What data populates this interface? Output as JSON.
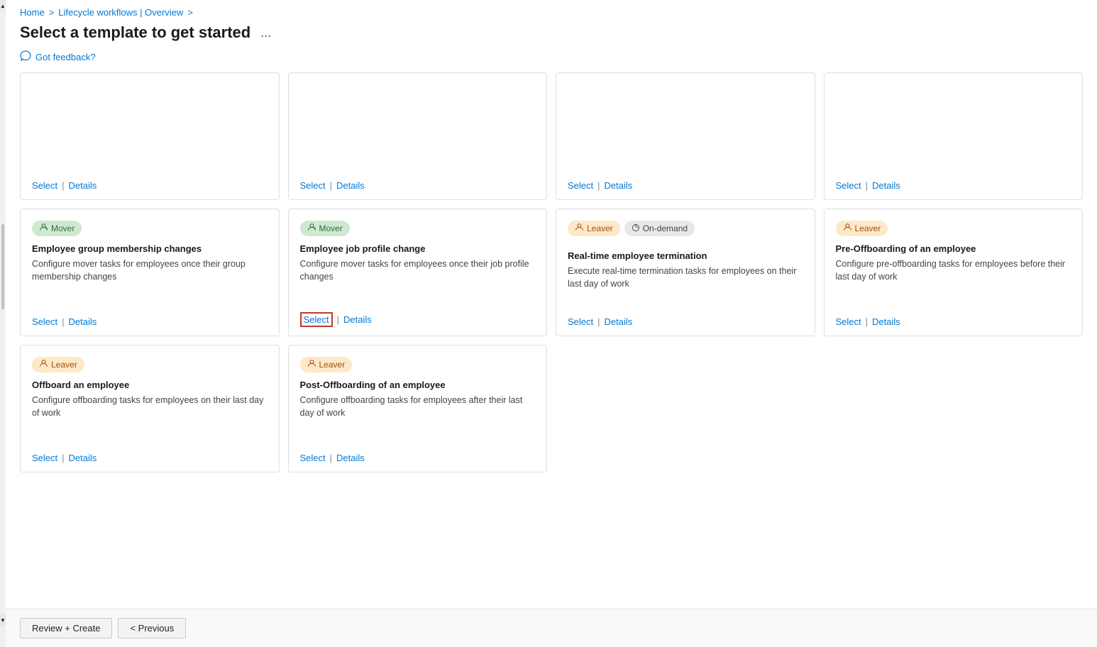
{
  "breadcrumb": {
    "home": "Home",
    "parent": "Lifecycle workflows | Overview",
    "sep1": ">",
    "sep2": ">"
  },
  "page": {
    "title": "Select a template to get started",
    "more_icon": "...",
    "feedback_icon": "💬",
    "feedback_text": "Got feedback?"
  },
  "cards_row1": [
    {
      "badge_type": "joiner",
      "badge_icon": "👤",
      "badge_label": "",
      "title": "",
      "desc": "",
      "select": "Select",
      "details": "Details"
    },
    {
      "badge_type": "joiner",
      "badge_icon": "👤",
      "badge_label": "",
      "title": "",
      "desc": "",
      "select": "Select",
      "details": "Details"
    },
    {
      "badge_type": "joiner",
      "badge_icon": "👤",
      "badge_label": "",
      "title": "",
      "desc": "",
      "select": "Select",
      "details": "Details"
    },
    {
      "badge_type": "joiner",
      "badge_icon": "👤",
      "badge_label": "",
      "title": "",
      "desc": "",
      "select": "Select",
      "details": "Details"
    }
  ],
  "cards_row2": [
    {
      "badge_type": "mover",
      "badge_icon": "🔄",
      "badge_label": "Mover",
      "title": "Employee group membership changes",
      "desc": "Configure mover tasks for employees once their group membership changes",
      "select": "Select",
      "details": "Details"
    },
    {
      "badge_type": "mover",
      "badge_icon": "🔄",
      "badge_label": "Mover",
      "title": "Employee job profile change",
      "desc": "Configure mover tasks for employees once their job profile changes",
      "select": "Select",
      "details": "Details",
      "select_highlighted": true
    },
    {
      "badge_type": "leaver",
      "badge_icon": "👤",
      "badge_label": "Leaver",
      "badge2_type": "ondemand",
      "badge2_label": "On-demand",
      "title": "Real-time employee termination",
      "desc": "Execute real-time termination tasks for employees on their last day of work",
      "select": "Select",
      "details": "Details"
    },
    {
      "badge_type": "leaver",
      "badge_icon": "👤",
      "badge_label": "Leaver",
      "title": "Pre-Offboarding of an employee",
      "desc": "Configure pre-offboarding tasks for employees before their last day of work",
      "select": "Select",
      "details": "Details"
    }
  ],
  "cards_row3": [
    {
      "badge_type": "leaver",
      "badge_icon": "👤",
      "badge_label": "Leaver",
      "title": "Offboard an employee",
      "desc": "Configure offboarding tasks for employees on their last day of work",
      "select": "Select",
      "details": "Details"
    },
    {
      "badge_type": "leaver",
      "badge_icon": "👤",
      "badge_label": "Leaver",
      "title": "Post-Offboarding of an employee",
      "desc": "Configure offboarding tasks for employees after their last day of work",
      "select": "Select",
      "details": "Details"
    }
  ],
  "bottom_bar": {
    "review_create": "Review + Create",
    "previous": "< Previous"
  },
  "scrollbar": {
    "up": "▲",
    "down": "▼"
  }
}
